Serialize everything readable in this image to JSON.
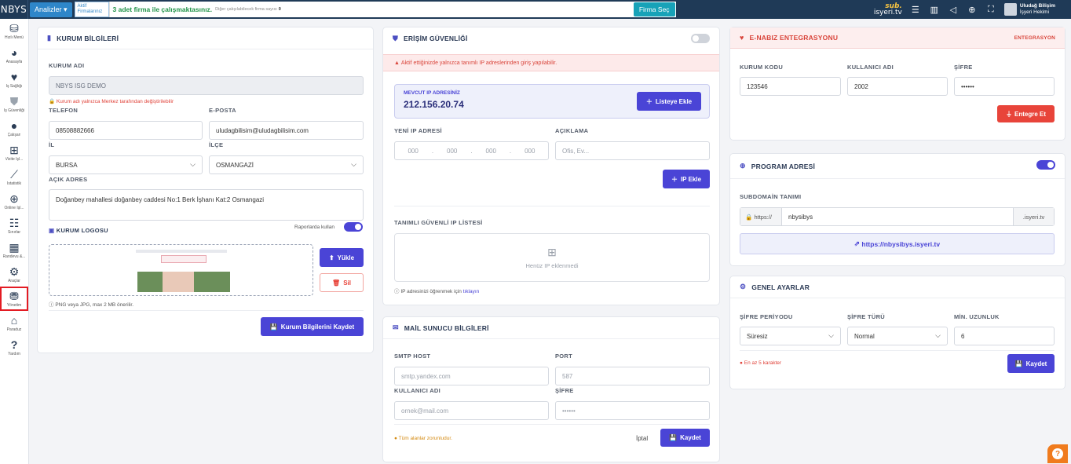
{
  "topbar": {
    "logo": "NBYS",
    "analiz": "Analizler",
    "aktif": "Aktif Firmalarınız",
    "firma_msg": "3 adet firma ile çalışmaktasınız.",
    "firma_sub": "Diğer çalışılabilecek firma sayısı",
    "firma_sub_count": "0",
    "firma_sec": "Firma Seç",
    "brand_top": "sub.",
    "brand_bottom": "isyeri.tv",
    "user_name": "Uludağ Bilişim",
    "user_role": "İşyeri Hekimi"
  },
  "sidebar": [
    {
      "label": "Hızlı Menü",
      "icon": "menu-icon"
    },
    {
      "label": "Anasayfa",
      "icon": "chart-pie-icon"
    },
    {
      "label": "İş Sağlığı",
      "icon": "heartbeat-icon"
    },
    {
      "label": "İş Güvenliği",
      "icon": "shield-icon"
    },
    {
      "label": "Çalışan",
      "icon": "user-icon"
    },
    {
      "label": "Vizite İşl...",
      "icon": "medical-icon"
    },
    {
      "label": "İstatistik",
      "icon": "line-chart-icon"
    },
    {
      "label": "Online İşl...",
      "icon": "globe-icon"
    },
    {
      "label": "Sınırlar",
      "icon": "sliders-icon"
    },
    {
      "label": "Randevu &...",
      "icon": "calendar-icon"
    },
    {
      "label": "Araçlar",
      "icon": "cogs-icon"
    },
    {
      "label": "Yönetim",
      "icon": "cubes-icon"
    },
    {
      "label": "Paraduz",
      "icon": "bank-icon"
    },
    {
      "label": "Yardım",
      "icon": "question-icon"
    }
  ],
  "kurum": {
    "title": "KURUM BİLGİLERİ",
    "ad_label": "KURUM ADI",
    "ad_value": "NBYS ISG DEMO",
    "ad_warning": "Kurum adı yalnızca Merkez tarafından değiştirilebilir",
    "tel_label": "TELEFON",
    "tel_value": "08508882666",
    "mail_label": "E-POSTA",
    "mail_value": "uludagbilisim@uludagbilisim.com",
    "il_label": "İL",
    "il_value": "BURSA",
    "ilce_label": "İLÇE",
    "ilce_value": "OSMANGAZİ",
    "adres_label": "AÇIK ADRES",
    "adres_value": "Doğanbey mahallesi doğanbey caddesi No:1 Berk İşhanı Kat:2 Osmangazi",
    "logo_label": "KURUM LOGOSU",
    "rapor_label": "Raporlarda kullan",
    "yukle": "Yükle",
    "sil": "Sil",
    "logo_hint": "PNG veya JPG, max 2 MB önerilir.",
    "kaydet": "Kurum Bilgilerini Kaydet"
  },
  "erisim": {
    "title": "ERİŞİM GÜVENLİĞİ",
    "alert": "Aktif ettiğinizde yalnızca tanımlı IP adreslerinden giriş yapılabilir.",
    "mevcut_label": "MEVCUT IP ADRESİNİZ",
    "mevcut_ip": "212.156.20.74",
    "listeye_ekle": "Listeye Ekle",
    "yeni_label": "YENİ IP ADRESİ",
    "ip_parts": [
      "000",
      "000",
      "000",
      "000"
    ],
    "aciklama_label": "AÇIKLAMA",
    "aciklama_ph": "Ofis, Ev...",
    "ip_ekle": "IP Ekle",
    "liste_label": "TANIMLI GÜVENLİ IP LİSTESİ",
    "bos": "Henüz IP eklenmedi",
    "hint": "IP adresinizi öğrenmek için",
    "hint_link": "tıklayın"
  },
  "mail": {
    "title": "MAİL SUNUCU BİLGİLERİ",
    "smtp_label": "SMTP HOST",
    "smtp_ph": "smtp.yandex.com",
    "port_label": "PORT",
    "port_ph": "587",
    "kul_label": "KULLANICI ADI",
    "kul_ph": "ornek@mail.com",
    "sifre_label": "ŞİFRE",
    "sifre_ph": "••••••",
    "zorunlu": "Tüm alanlar zorunludur.",
    "iptal": "İptal",
    "kaydet": "Kaydet"
  },
  "enabiz": {
    "title": "E-NABIZ ENTEGRASYONU",
    "badge": "ENTEGRASYON",
    "kod_label": "KURUM KODU",
    "kod_value": "123546",
    "kul_label": "KULLANICI ADI",
    "kul_value": "2002",
    "sifre_label": "ŞİFRE",
    "sifre_value": "••••••",
    "entegre": "Entegre Et"
  },
  "program": {
    "title": "PROGRAM ADRESİ",
    "sub_label": "SUBDOMAİN TANIMI",
    "prefix": "https://",
    "value": "nbysibys",
    "suffix": ".isyeri.tv",
    "link": "https://nbysibys.isyeri.tv"
  },
  "genel": {
    "title": "GENEL AYARLAR",
    "periyot_label": "ŞİFRE PERİYODU",
    "periyot_value": "Süresiz",
    "tur_label": "ŞİFRE TÜRÜ",
    "tur_value": "Normal",
    "min_label": "MİN. UZUNLUK",
    "min_value": "6",
    "uyari": "En az 5 karakter",
    "kaydet": "Kaydet"
  },
  "colors": {
    "primary": "#4a44d6",
    "danger": "#e8443a",
    "topbar": "#1f3a57"
  }
}
